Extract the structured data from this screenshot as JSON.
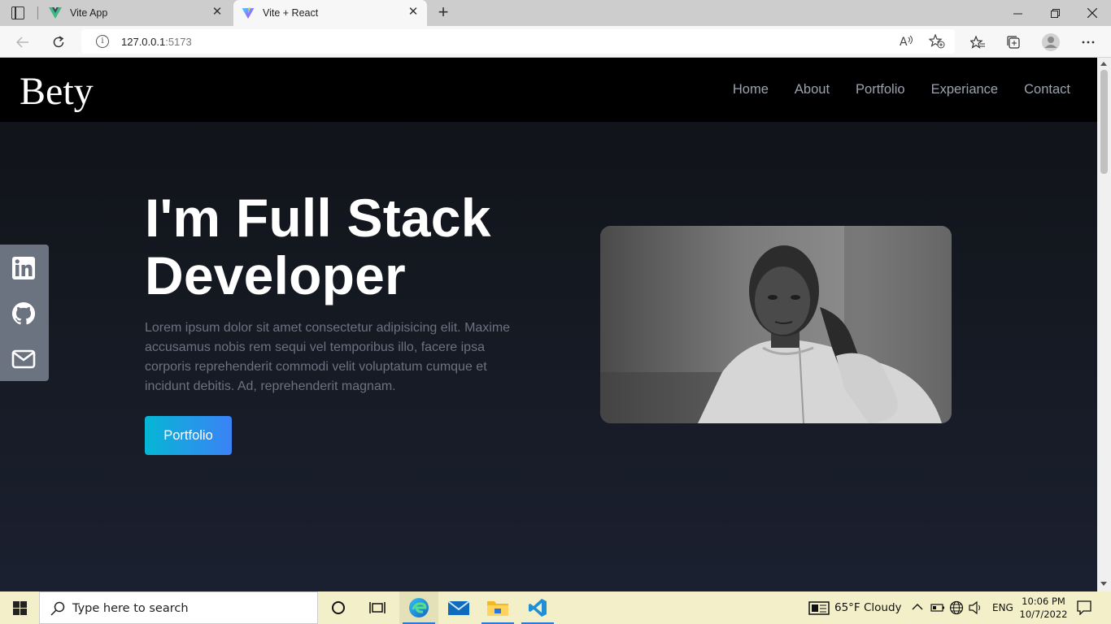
{
  "browser": {
    "tabs": [
      {
        "title": "Vite App",
        "favicon": "vue-logo-icon",
        "active": false
      },
      {
        "title": "Vite + React",
        "favicon": "vite-logo-icon",
        "active": true
      }
    ],
    "url_host": "127.0.0.1",
    "url_port": ":5173"
  },
  "site": {
    "logo": "Bety",
    "nav": [
      "Home",
      "About",
      "Portfolio",
      "Experiance",
      "Contact"
    ],
    "hero": {
      "title_line1": "I'm Full Stack",
      "title_line2": "Developer",
      "description": "Lorem ipsum dolor sit amet consectetur adipisicing elit. Maxime accusamus nobis rem sequi vel temporibus illo, facere ipsa corporis reprehenderit commodi velit voluptatum cumque et incidunt debitis. Ad, reprehenderit magnam.",
      "button": "Portfolio"
    },
    "social": [
      "linkedin-icon",
      "github-icon",
      "mail-icon"
    ],
    "colors": {
      "button_from": "#06b6d4",
      "button_to": "#3b82f6",
      "social_bar": "#6b7280"
    }
  },
  "taskbar": {
    "search_placeholder": "Type here to search",
    "weather": "65°F  Cloudy",
    "language": "ENG",
    "time": "10:06 PM",
    "date": "10/7/2022"
  }
}
